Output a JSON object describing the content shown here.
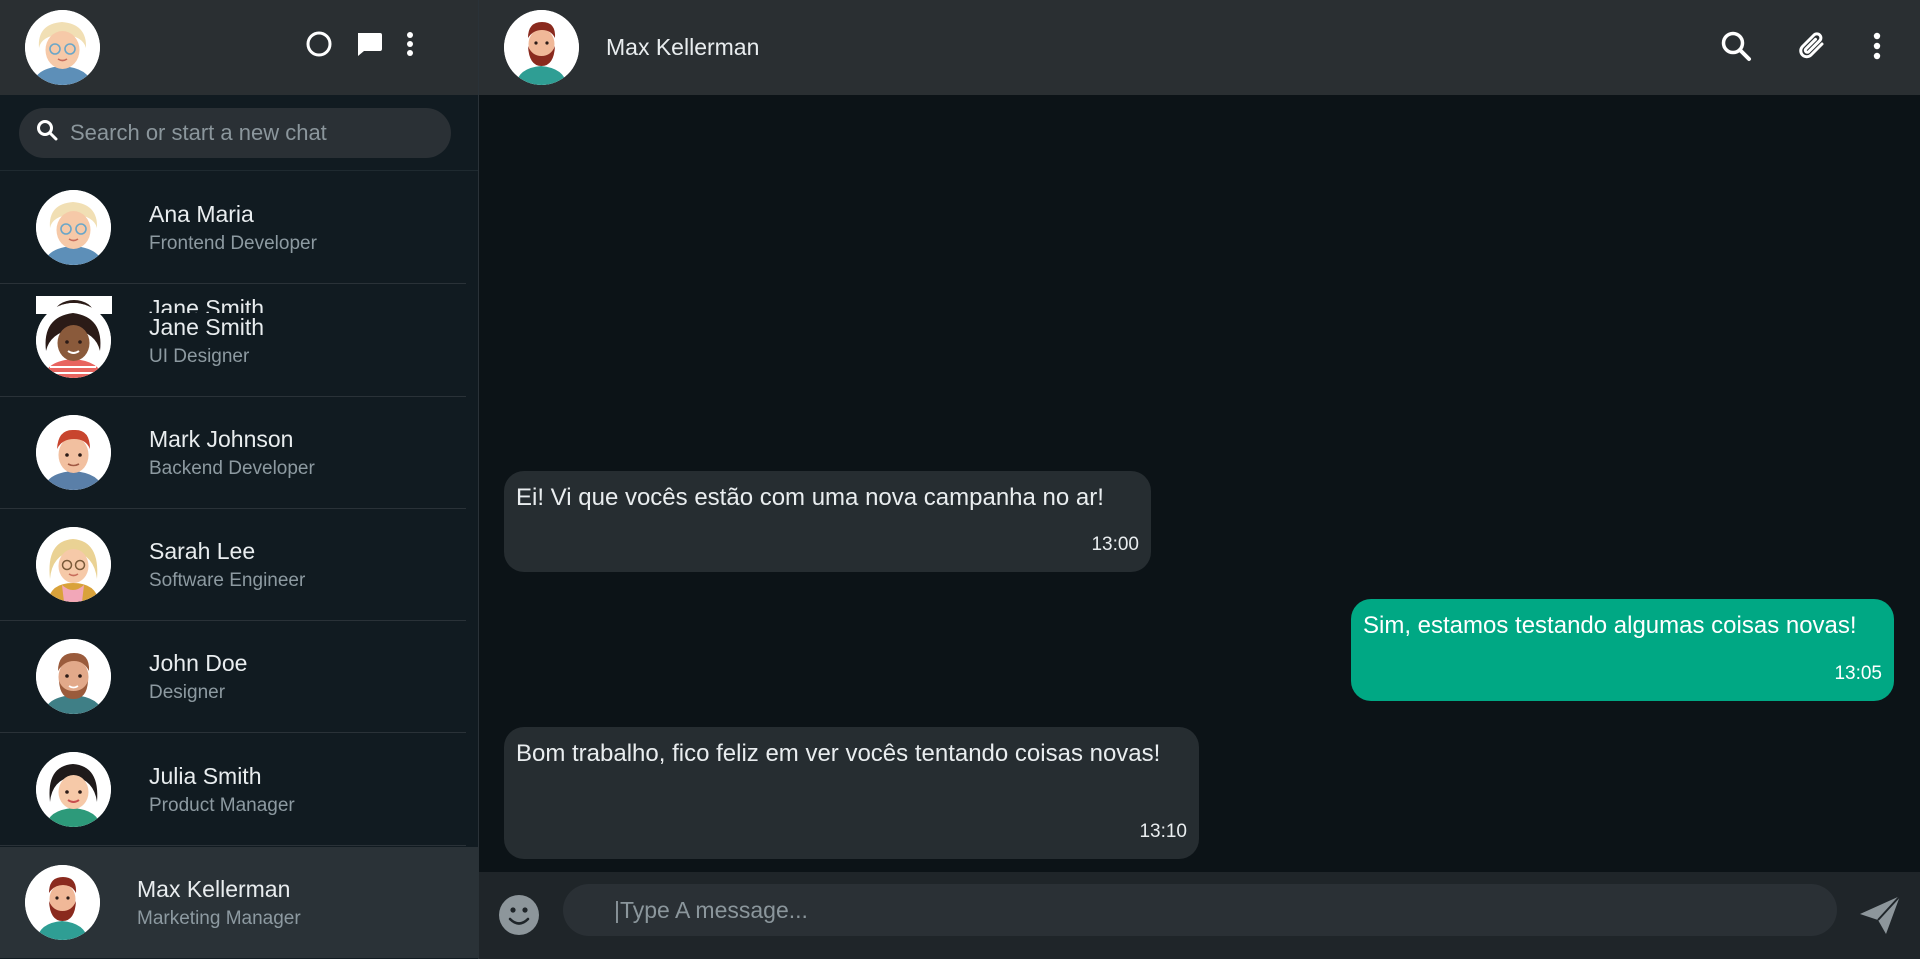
{
  "sidebar": {
    "search": {
      "placeholder": "Search or start a new chat"
    },
    "contacts": [
      {
        "name": "Ana Maria",
        "role": "Frontend Developer"
      },
      {
        "name": "Jane Smith",
        "role": "UI Designer"
      },
      {
        "name": "Mark Johnson",
        "role": "Backend Developer"
      },
      {
        "name": "Sarah Lee",
        "role": "Software Engineer"
      },
      {
        "name": "John Doe",
        "role": "Designer"
      },
      {
        "name": "Julia Smith",
        "role": "Product Manager"
      },
      {
        "name": "Max Kellerman",
        "role": "Marketing Manager"
      }
    ],
    "active_contact": "Max Kellerman"
  },
  "chat": {
    "contact_name": "Max Kellerman",
    "messages": [
      {
        "direction": "incoming",
        "text": "Ei! Vi que vocês estão com uma nova campanha no ar!",
        "time": "13:00"
      },
      {
        "direction": "outgoing",
        "text": "Sim, estamos testando algumas coisas novas!",
        "time": "13:05"
      },
      {
        "direction": "incoming",
        "text": "Bom trabalho, fico feliz em ver vocês tentando coisas novas!",
        "time": "13:10"
      }
    ],
    "composer": {
      "placeholder": "|Type A message..."
    }
  },
  "icons": {
    "status": "status-circle-icon",
    "new_chat": "chat-bubble-icon",
    "menu": "vertical-dots-icon",
    "search": "search-icon",
    "attach": "paperclip-icon",
    "emoji": "emoji-icon",
    "send": "send-icon"
  },
  "colors": {
    "accent": "#00a884",
    "header_bg": "#2a2f32",
    "sidebar_bg": "#111b21",
    "chat_bg": "#0c1317",
    "incoming_bubble": "#262d31"
  }
}
